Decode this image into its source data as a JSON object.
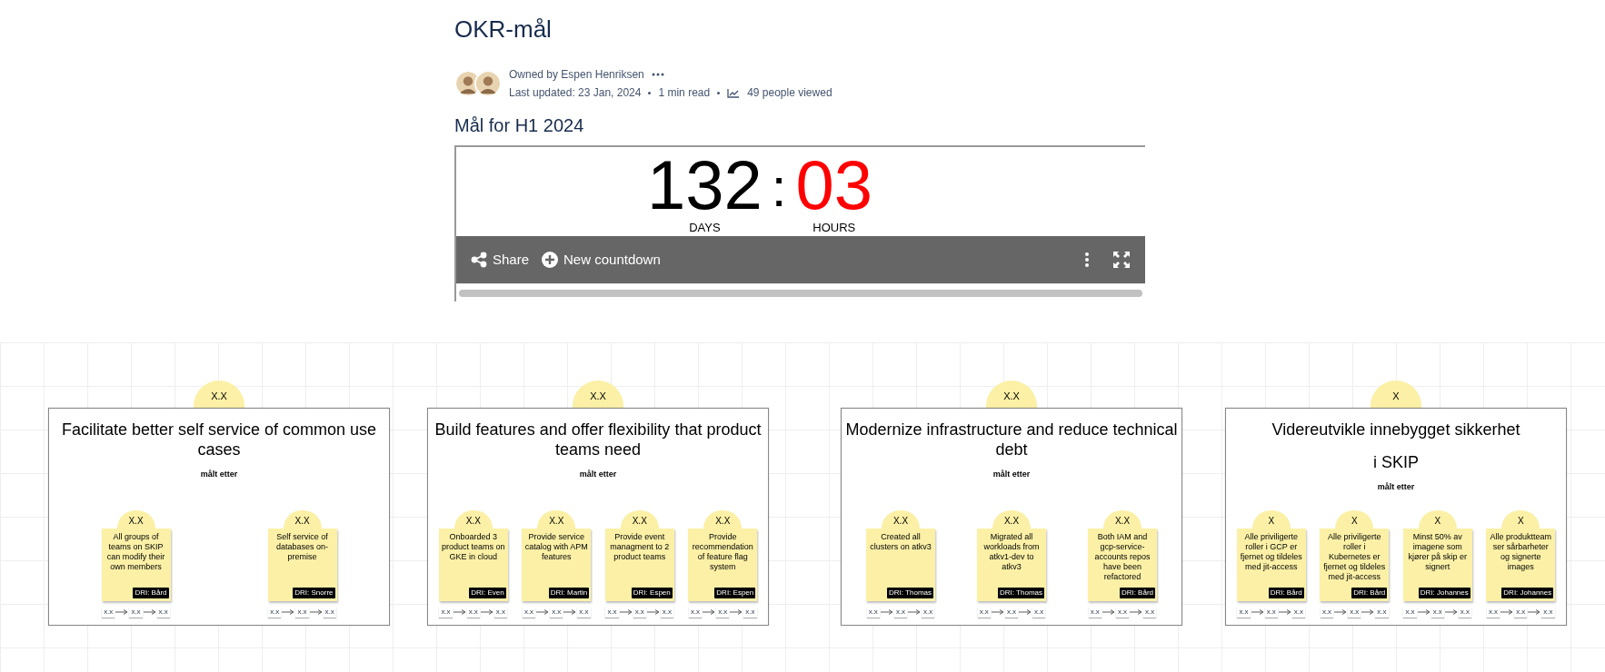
{
  "page": {
    "title": "OKR-mål",
    "owner": "Owned by Espen Henriksen",
    "updated": "Last updated: 23 Jan, 2024",
    "read_time": "1 min read",
    "views": "49 people viewed"
  },
  "section_heading": "Mål for H1 2024",
  "countdown": {
    "units": [
      {
        "value": "132",
        "label": "DAYS",
        "highlight": false
      },
      {
        "value": "03",
        "label": "HOURS",
        "highlight": true
      }
    ],
    "separator": ":",
    "actions": [
      {
        "kind": "share",
        "label": "Share"
      },
      {
        "kind": "add",
        "label": "New countdown"
      }
    ]
  },
  "objectives": [
    {
      "badge": "X.X",
      "title": [
        "Facilitate better self service of common use cases"
      ],
      "measured_by": "målt etter",
      "key_results": [
        {
          "badge": "X.X",
          "text": "All groups of teams on SKIP can modify their own members",
          "dri": "DRI: Bård",
          "steps": [
            "x.x",
            "x.x",
            "x.x"
          ]
        },
        {
          "badge": "X.X",
          "text": "Self service of databases on-premise",
          "dri": "DRI: Snorre",
          "steps": [
            "x.x",
            "x.x",
            "x.x"
          ]
        }
      ]
    },
    {
      "badge": "X.X",
      "title": [
        "Build features and offer flexibility that product teams need"
      ],
      "measured_by": "målt etter",
      "key_results": [
        {
          "badge": "X.X",
          "text": "Onboarded 3 product teams on GKE in cloud",
          "dri": "DRI: Even",
          "steps": [
            "x.x",
            "x.x",
            "x.x"
          ]
        },
        {
          "badge": "X.X",
          "text": "Provide service catalog with APM features",
          "dri": "DRI: Martin",
          "steps": [
            "x.x",
            "x.x",
            "x.x"
          ]
        },
        {
          "badge": "X.X",
          "text": "Provide event managment to 2 product teams",
          "dri": "DRI: Espen",
          "steps": [
            "x.x",
            "x.x",
            "x.x"
          ]
        },
        {
          "badge": "X.X",
          "text": "Provide recommendation of feature flag system",
          "dri": "DRI: Espen",
          "steps": [
            "x.x",
            "x.x",
            "x.x"
          ]
        }
      ]
    },
    {
      "badge": "X.X",
      "title": [
        "Modernize infrastructure and reduce technical debt"
      ],
      "measured_by": "målt etter",
      "key_results": [
        {
          "badge": "X.X",
          "text": "Created all clusters on atkv3",
          "dri": "DRI: Thomas",
          "steps": [
            "x.x",
            "x.x",
            "x.x"
          ]
        },
        {
          "badge": "X.X",
          "text": "Migrated all workloads from atkv1-dev to atkv3",
          "dri": "DRI: Thomas",
          "steps": [
            "x.x",
            "x.x",
            "x.x"
          ]
        },
        {
          "badge": "X.X",
          "text": "Both IAM and gcp-service-accounts repos have been refactored",
          "dri": "DRI: Bård",
          "steps": [
            "x.x",
            "x.x",
            "x.x"
          ]
        }
      ]
    },
    {
      "badge": "X",
      "title": [
        "Videreutvikle innebygget sikkerhet",
        "i SKIP"
      ],
      "measured_by": "målt etter",
      "key_results": [
        {
          "badge": "X",
          "text": "Alle priviligerte roller i GCP er fjernet og tildeles med jit-access",
          "dri": "DRI: Bård",
          "steps": [
            "x.x",
            "x.x",
            "x.x"
          ]
        },
        {
          "badge": "X",
          "text": "Alle priviligerte roller i Kubernetes er fjernet og tildeles med jit-access",
          "dri": "DRI: Bård",
          "steps": [
            "x.x",
            "x.x",
            "x.x"
          ]
        },
        {
          "badge": "X",
          "text": "Minst 50% av imagene som kjører på skip er signert",
          "dri": "DRI: Johannes",
          "steps": [
            "x.x",
            "x.x",
            "x.x"
          ]
        },
        {
          "badge": "X",
          "text": "Alle produktteam ser sårbarheter og signerte images",
          "dri": "DRI: Johannes",
          "steps": [
            "x.x",
            "x.x",
            "x.x"
          ]
        }
      ]
    }
  ]
}
